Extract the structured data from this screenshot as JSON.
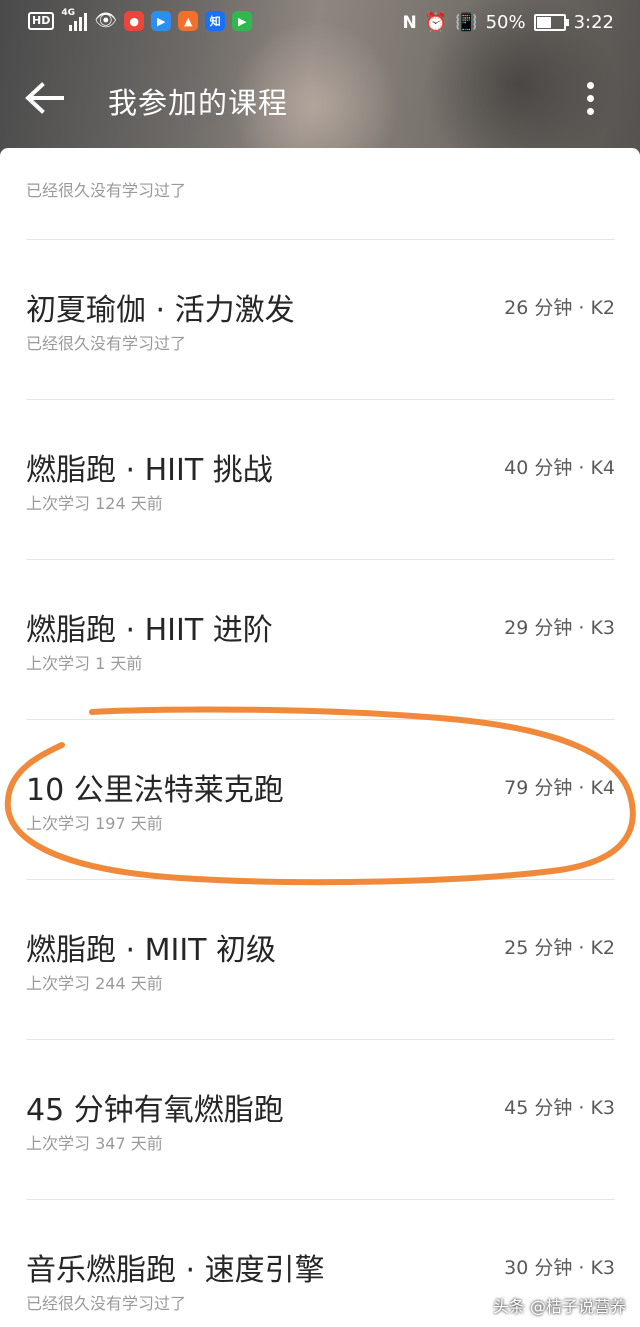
{
  "status_bar": {
    "hd": "HD",
    "network": "4G",
    "apps": [
      {
        "icon": "weibo-app-icon",
        "text": "",
        "color": "#e8473c"
      },
      {
        "icon": "youku-app-icon",
        "text": "",
        "color": "#2a8ff0"
      },
      {
        "icon": "video-app-icon",
        "text": "",
        "color": "#f2702a"
      },
      {
        "icon": "zhihu-app-icon",
        "text": "知",
        "color": "#1772f6"
      },
      {
        "icon": "tencent-video-app-icon",
        "text": "",
        "color": "#2fb84f"
      }
    ],
    "nfc": "N",
    "battery": "50%",
    "time": "3:22"
  },
  "app_bar": {
    "title": "我参加的课程"
  },
  "first_partial": {
    "sub": "已经很久没有学习过了"
  },
  "courses": [
    {
      "name": "初夏瑜伽 · 活力激发",
      "meta": "26 分钟 · K2",
      "sub": "已经很久没有学习过了"
    },
    {
      "name": "燃脂跑 · HIIT 挑战",
      "meta": "40 分钟 · K4",
      "sub": "上次学习 124 天前"
    },
    {
      "name": "燃脂跑 · HIIT 进阶",
      "meta": "29 分钟 · K3",
      "sub": "上次学习 1 天前"
    },
    {
      "name": "10 公里法特莱克跑",
      "meta": "79 分钟 · K4",
      "sub": "上次学习 197 天前"
    },
    {
      "name": "燃脂跑 · MIIT 初级",
      "meta": "25 分钟 · K2",
      "sub": "上次学习 244 天前"
    },
    {
      "name": "45 分钟有氧燃脂跑",
      "meta": "45 分钟 · K3",
      "sub": "上次学习 347 天前"
    },
    {
      "name": "音乐燃脂跑 · 速度引擎",
      "meta": "30 分钟 · K3",
      "sub": "已经很久没有学习过了"
    }
  ],
  "annotation": {
    "color": "#f08a3a"
  },
  "watermark": "头条 @桔子说营养"
}
